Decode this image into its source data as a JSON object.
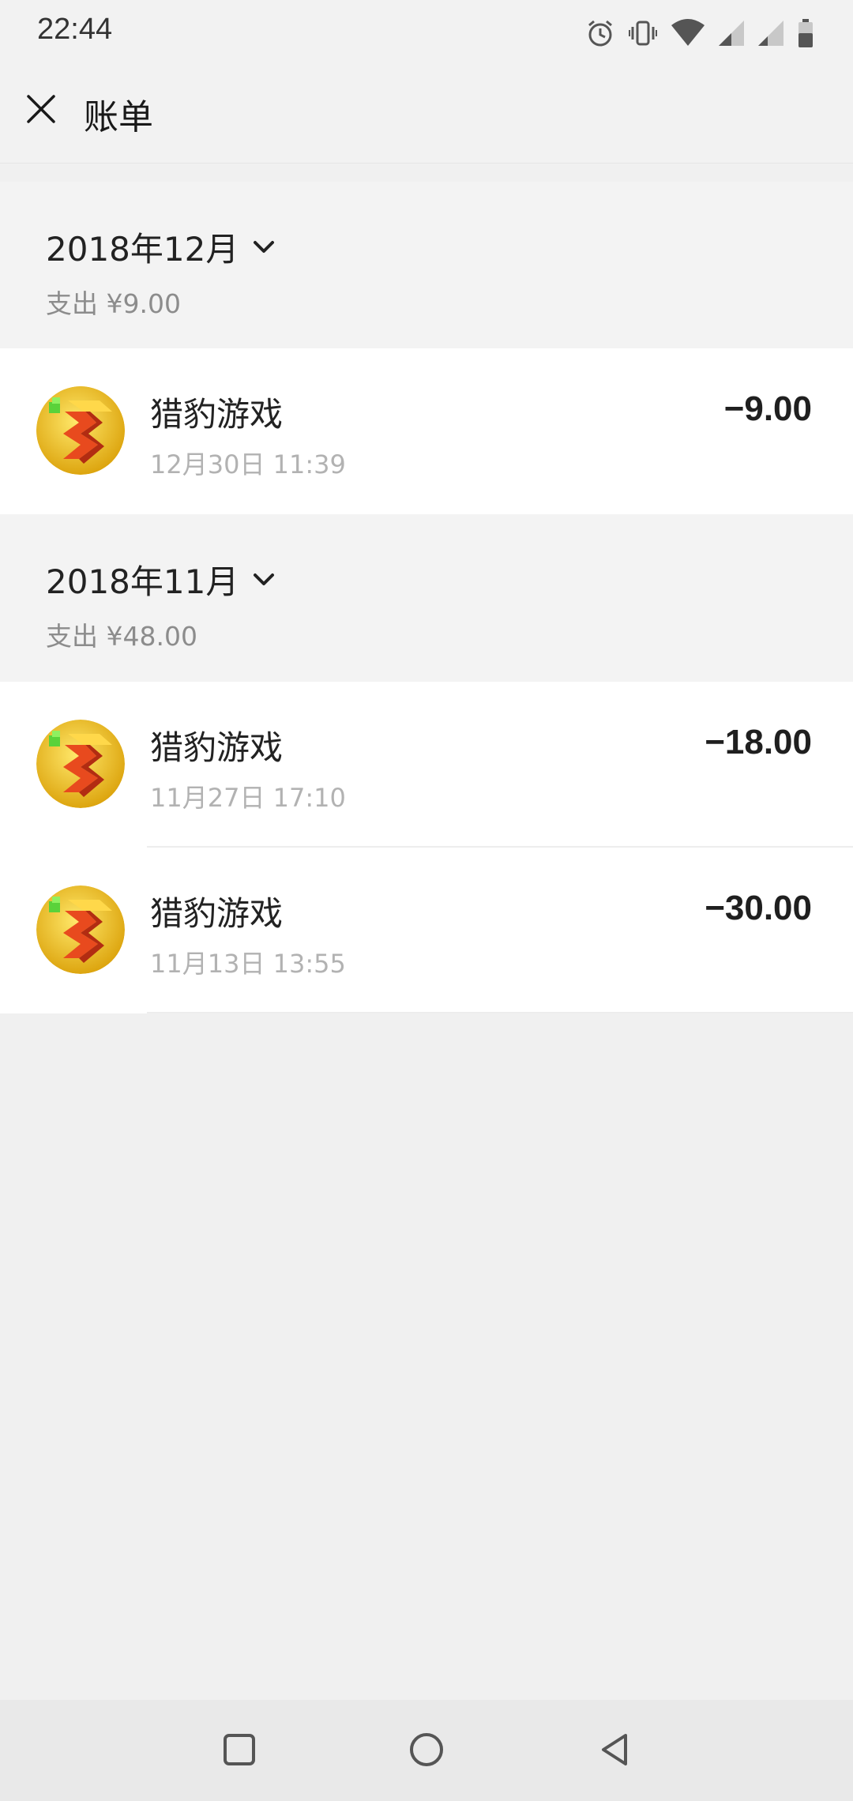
{
  "status_bar": {
    "time": "22:44",
    "icons": [
      "alarm-icon",
      "vibrate-icon",
      "wifi-icon",
      "signal-icon",
      "signal-icon",
      "battery-icon"
    ]
  },
  "header": {
    "title": "账单",
    "close_icon": "close-icon"
  },
  "months": [
    {
      "title": "2018年12月",
      "summary": "支出 ¥9.00",
      "transactions": [
        {
          "name": "猎豹游戏",
          "time": "12月30日 11:39",
          "amount": "−9.00"
        }
      ]
    },
    {
      "title": "2018年11月",
      "summary": "支出 ¥48.00",
      "transactions": [
        {
          "name": "猎豹游戏",
          "time": "11月27日 17:10",
          "amount": "−18.00"
        },
        {
          "name": "猎豹游戏",
          "time": "11月13日 13:55",
          "amount": "−30.00"
        }
      ]
    }
  ],
  "nav_bar": {
    "buttons": [
      "recents-icon",
      "home-icon",
      "back-icon"
    ]
  },
  "colors": {
    "background": "#f0f0f0",
    "card": "#ffffff",
    "primary_text": "#222222",
    "secondary_text": "#b2b2b2"
  }
}
